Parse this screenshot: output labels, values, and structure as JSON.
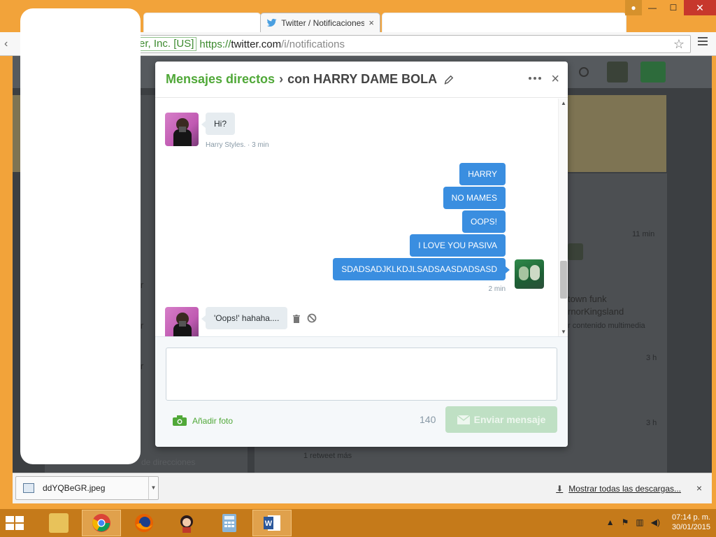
{
  "browser": {
    "tab_active_title": "Twitter / Notificaciones",
    "tab_close": "×",
    "ev_cert_label": "er, Inc. [US]",
    "url_scheme": "https://",
    "url_host": "twitter.com",
    "url_path": "/i/notifications"
  },
  "background": {
    "texts": [
      "Mensajes directos",
      "11 min",
      "town funk",
      "rnorKingsland",
      "r contenido multimedia",
      "3 h",
      "3 h",
      "1 retweet más",
      "de direcciones",
      "ir",
      "ir",
      "ir"
    ]
  },
  "dm": {
    "title": "Mensajes directos",
    "separator": "›",
    "with_label": "con HARRY DAME BOLA",
    "close": "×",
    "messages_in": [
      {
        "text": "Hi?",
        "meta": "Harry Styles. · 3 min"
      },
      {
        "text": "'Oops!' hahaha...."
      }
    ],
    "messages_out": [
      "HARRY",
      "NO MAMES",
      "OOPS!",
      "I LOVE YOU PASIVA",
      "SDADSADJKLKDJLSADSAASDADSASD"
    ],
    "out_meta": "2 min",
    "add_photo": "Añadir foto",
    "char_count": "140",
    "send_label": "Enviar mensaje",
    "accent_color": "#50a838",
    "bubble_out_color": "#3a8ee0"
  },
  "downloads": {
    "file_name": "ddYQBeGR.jpeg",
    "show_all": "Mostrar todas las descargas...",
    "close": "×"
  },
  "taskbar": {
    "time": "07:14 p. m.",
    "date": "30/01/2015"
  }
}
